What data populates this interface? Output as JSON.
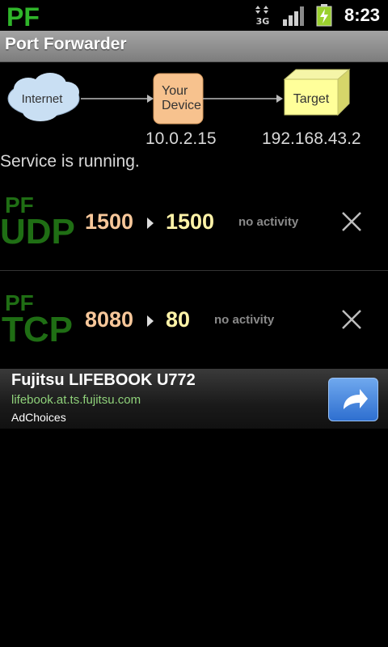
{
  "statusbar": {
    "app_icon": "pf-logo-icon",
    "network_label": "3G",
    "time": "8:23"
  },
  "titlebar": {
    "title": "Port Forwarder"
  },
  "diagram": {
    "internet_label": "Internet",
    "device_label_line1": "Your",
    "device_label_line2": "Device",
    "target_label": "Target",
    "device_ip": "10.0.2.15",
    "target_ip": "192.168.43.2"
  },
  "service_status": "Service is running.",
  "rules": [
    {
      "protocol": "UDP",
      "logo_prefix": "PF",
      "source_port": "1500",
      "dest_port": "1500",
      "activity": "no activity"
    },
    {
      "protocol": "TCP",
      "logo_prefix": "PF",
      "source_port": "8080",
      "dest_port": "80",
      "activity": "no activity"
    }
  ],
  "ad": {
    "title": "Fujitsu LIFEBOOK U772",
    "url": "lifebook.at.ts.fujitsu.com",
    "choices": "AdChoices",
    "button_icon": "share-arrow-icon"
  },
  "colors": {
    "source_port": "#f7c79a",
    "dest_port": "#fff3a8",
    "logo_green": "#1f6e14",
    "ad_url": "#8fd17a"
  }
}
